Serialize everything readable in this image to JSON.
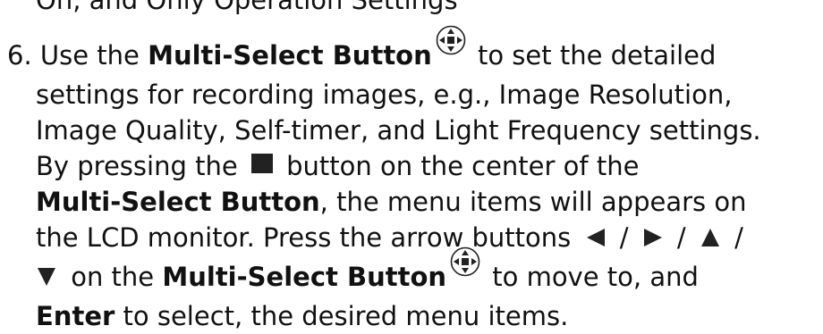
{
  "prev_line": "On, and Only Operation Settings",
  "step": {
    "line1": {
      "number": "6. ",
      "pre": "Use the ",
      "bold": "Multi-Select Button",
      "post": " to set the detailed"
    },
    "line2": "settings for recording images, e.g., Image Resolution,",
    "line3": "Image Quality, Self-timer, and Light Frequency settings.",
    "line4": {
      "pre": "By pressing the ",
      "post": " button on the center of the"
    },
    "line5": {
      "bold": "Multi-Select Button",
      "post": ", the menu items will appears on"
    },
    "line6": {
      "pre": "the LCD monitor. Press the arrow buttons ",
      "sep1": " / ",
      "sep2": " / ",
      "sep3": " /"
    },
    "line7": {
      "mid": " on the ",
      "bold": "Multi-Select Button",
      "post": " to move to, and"
    },
    "line8": {
      "bold": "Enter",
      "post": " to select, the desired menu items."
    }
  },
  "icons": {
    "multi_select": "multi-select-button-icon",
    "center_button": "center-square-button-icon",
    "arrows": [
      "left-arrow-icon",
      "right-arrow-icon",
      "up-arrow-icon",
      "down-arrow-icon"
    ]
  }
}
